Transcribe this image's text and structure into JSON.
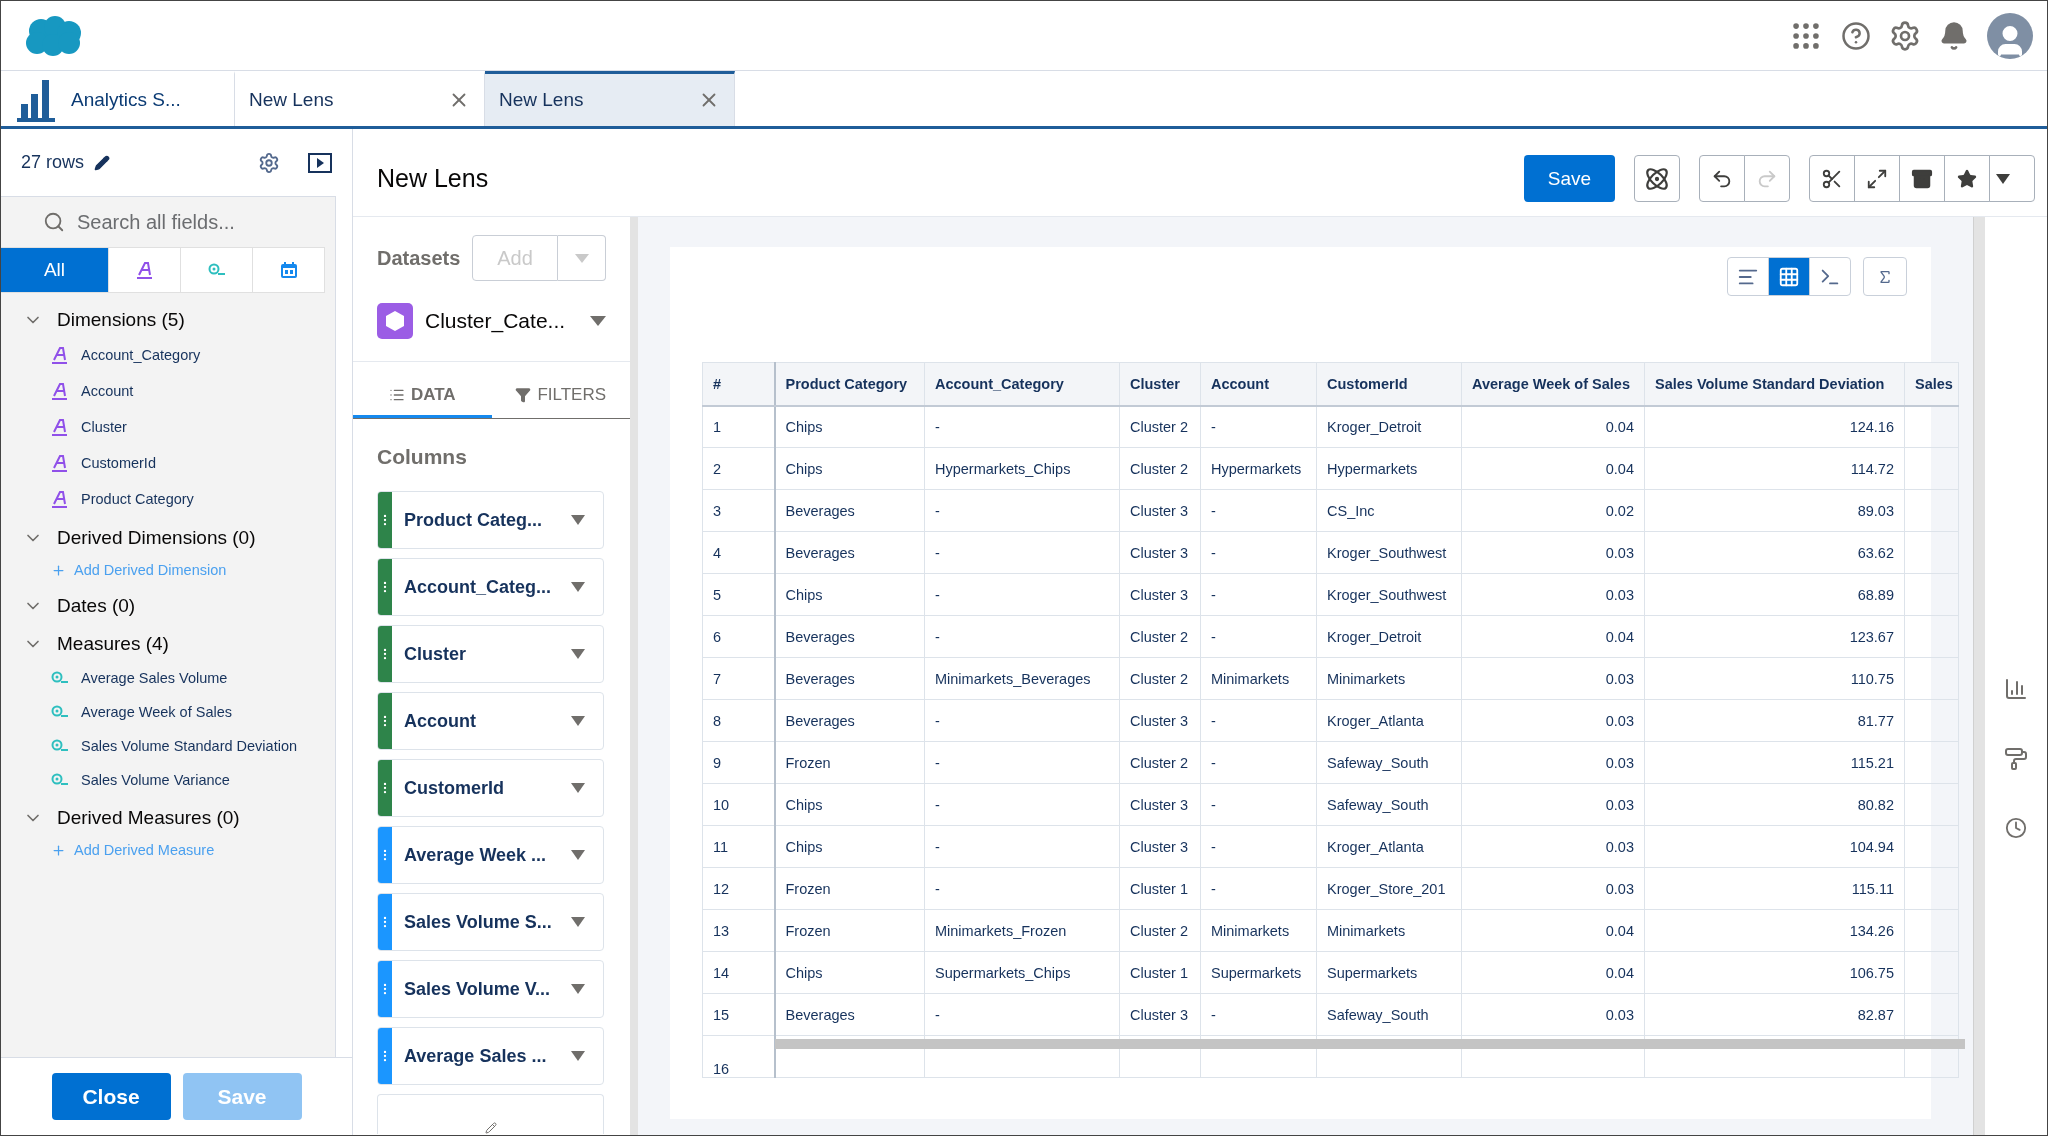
{
  "tabs": [
    {
      "label": "Analytics S...",
      "kind": "app",
      "selected": false
    },
    {
      "label": "New Lens",
      "kind": "lens",
      "selected": false
    },
    {
      "label": "New Lens",
      "kind": "lens",
      "selected": true
    }
  ],
  "sidebar": {
    "row_count": "27 rows",
    "search": {
      "placeholder": "Search all fields..."
    },
    "type_filters": [
      {
        "kind": "all",
        "label": "All",
        "selected": true
      },
      {
        "kind": "dimension",
        "selected": false
      },
      {
        "kind": "measure",
        "selected": false
      },
      {
        "kind": "date",
        "selected": false
      }
    ],
    "sections": [
      {
        "title": "Dimensions (5)",
        "expanded": true,
        "items": [
          {
            "label": "Account_Category",
            "kind": "dimension"
          },
          {
            "label": "Account",
            "kind": "dimension"
          },
          {
            "label": "Cluster",
            "kind": "dimension"
          },
          {
            "label": "CustomerId",
            "kind": "dimension"
          },
          {
            "label": "Product Category",
            "kind": "dimension"
          }
        ]
      },
      {
        "title": "Derived Dimensions (0)",
        "expanded": true,
        "add_link": "Add Derived Dimension"
      },
      {
        "title": "Dates (0)",
        "expanded": true
      },
      {
        "title": "Measures (4)",
        "expanded": true,
        "items": [
          {
            "label": "Average Sales Volume",
            "kind": "measure"
          },
          {
            "label": "Average Week of Sales",
            "kind": "measure"
          },
          {
            "label": "Sales Volume Standard Deviation",
            "kind": "measure"
          },
          {
            "label": "Sales Volume Variance",
            "kind": "measure"
          }
        ]
      },
      {
        "title": "Derived Measures (0)",
        "expanded": true,
        "add_link": "Add Derived Measure"
      }
    ],
    "buttons": [
      {
        "label": "Close",
        "disabled": false
      },
      {
        "label": "Save",
        "disabled": true
      }
    ]
  },
  "lens": {
    "title": "New Lens",
    "save": "Save",
    "datasets": {
      "label": "Datasets",
      "add": "Add",
      "add_disabled": true,
      "name": "Cluster_Cate..."
    },
    "panel_tabs": [
      {
        "label": "DATA",
        "kind": "data",
        "selected": true
      },
      {
        "label": "FILTERS",
        "kind": "filters",
        "selected": false
      }
    ],
    "columns_title": "Columns",
    "column_pills": [
      {
        "label": "Product Categ...",
        "kind": "dimension"
      },
      {
        "label": "Account_Categ...",
        "kind": "dimension"
      },
      {
        "label": "Cluster",
        "kind": "dimension"
      },
      {
        "label": "Account",
        "kind": "dimension"
      },
      {
        "label": "CustomerId",
        "kind": "dimension"
      },
      {
        "label": "Average Week ...",
        "kind": "measure"
      },
      {
        "label": "Sales Volume S...",
        "kind": "measure"
      },
      {
        "label": "Sales Volume V...",
        "kind": "measure"
      },
      {
        "label": "Average Sales ...",
        "kind": "measure"
      }
    ],
    "view_modes": [
      {
        "kind": "sort",
        "selected": false
      },
      {
        "kind": "table",
        "selected": true
      },
      {
        "kind": "query",
        "selected": false
      }
    ],
    "table": {
      "columns": [
        {
          "label": "#",
          "kind": "index"
        },
        {
          "label": "Product Category",
          "kind": "dimension"
        },
        {
          "label": "Account_Category",
          "kind": "dimension"
        },
        {
          "label": "Cluster",
          "kind": "dimension"
        },
        {
          "label": "Account",
          "kind": "dimension"
        },
        {
          "label": "CustomerId",
          "kind": "dimension"
        },
        {
          "label": "Average Week of Sales",
          "kind": "measure"
        },
        {
          "label": "Sales Volume Standard Deviation",
          "kind": "measure"
        },
        {
          "label": "Sales",
          "kind": "measure"
        }
      ],
      "rows": [
        [
          "1",
          "Chips",
          "-",
          "Cluster 2",
          "-",
          "Kroger_Detroit",
          "0.04",
          "124.16"
        ],
        [
          "2",
          "Chips",
          "Hypermarkets_Chips",
          "Cluster 2",
          "Hypermarkets",
          "Hypermarkets",
          "0.04",
          "114.72"
        ],
        [
          "3",
          "Beverages",
          "-",
          "Cluster 3",
          "-",
          "CS_Inc",
          "0.02",
          "89.03"
        ],
        [
          "4",
          "Beverages",
          "-",
          "Cluster 3",
          "-",
          "Kroger_Southwest",
          "0.03",
          "63.62"
        ],
        [
          "5",
          "Chips",
          "-",
          "Cluster 3",
          "-",
          "Kroger_Southwest",
          "0.03",
          "68.89"
        ],
        [
          "6",
          "Beverages",
          "-",
          "Cluster 2",
          "-",
          "Kroger_Detroit",
          "0.04",
          "123.67"
        ],
        [
          "7",
          "Beverages",
          "Minimarkets_Beverages",
          "Cluster 2",
          "Minimarkets",
          "Minimarkets",
          "0.03",
          "110.75"
        ],
        [
          "8",
          "Beverages",
          "-",
          "Cluster 3",
          "-",
          "Kroger_Atlanta",
          "0.03",
          "81.77"
        ],
        [
          "9",
          "Frozen",
          "-",
          "Cluster 2",
          "-",
          "Safeway_South",
          "0.03",
          "115.21"
        ],
        [
          "10",
          "Chips",
          "-",
          "Cluster 3",
          "-",
          "Safeway_South",
          "0.03",
          "80.82"
        ],
        [
          "11",
          "Chips",
          "-",
          "Cluster 3",
          "-",
          "Kroger_Atlanta",
          "0.03",
          "104.94"
        ],
        [
          "12",
          "Frozen",
          "-",
          "Cluster 1",
          "-",
          "Kroger_Store_201",
          "0.03",
          "115.11"
        ],
        [
          "13",
          "Frozen",
          "Minimarkets_Frozen",
          "Cluster 2",
          "Minimarkets",
          "Minimarkets",
          "0.04",
          "134.26"
        ],
        [
          "14",
          "Chips",
          "Supermarkets_Chips",
          "Cluster 1",
          "Supermarkets",
          "Supermarkets",
          "0.04",
          "106.75"
        ],
        [
          "15",
          "Beverages",
          "-",
          "Cluster 3",
          "-",
          "Safeway_South",
          "0.03",
          "82.87"
        ]
      ],
      "partial_row": "16"
    }
  }
}
